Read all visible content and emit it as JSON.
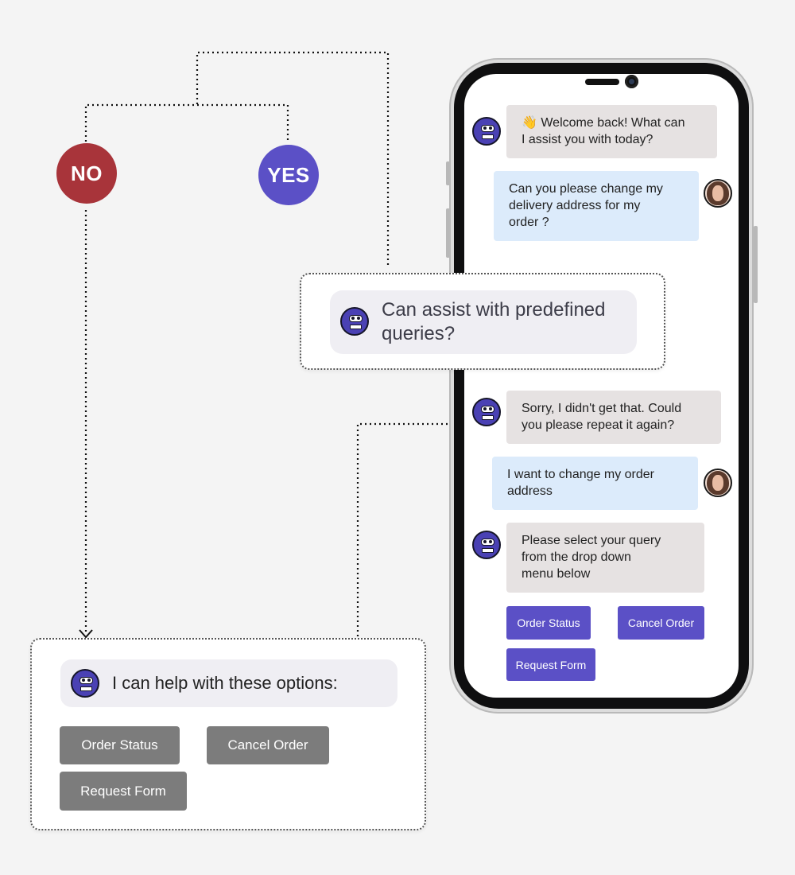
{
  "decision": {
    "no_label": "NO",
    "yes_label": "YES"
  },
  "phone_chat": {
    "messages": [
      {
        "sender": "bot",
        "text": "👋 Welcome back! What can\nI assist you with today?"
      },
      {
        "sender": "user",
        "text": "Can you please change my\ndelivery address for my\n order ?"
      },
      {
        "sender": "bot",
        "text": "Sorry, I didn't get that. Could\nyou please repeat it again?"
      },
      {
        "sender": "user",
        "text": "I want to change my order\naddress"
      },
      {
        "sender": "bot",
        "text": "Please select your query\nfrom the drop down\nmenu below"
      }
    ],
    "option_buttons": [
      "Order Status",
      "Cancel Order",
      "Request Form"
    ]
  },
  "query_card": {
    "text": "Can assist with predefined\nqueries?"
  },
  "options_card": {
    "title": "I can help with these options:",
    "buttons": [
      "Order Status",
      "Cancel Order",
      "Request Form"
    ]
  },
  "colors": {
    "no": "#a8343a",
    "yes": "#5b50c6",
    "bot_bubble": "#e6e2e2",
    "user_bubble": "#dcebfb",
    "option_button_phone": "#5b50c6",
    "option_button_card": "#7c7c7c"
  }
}
